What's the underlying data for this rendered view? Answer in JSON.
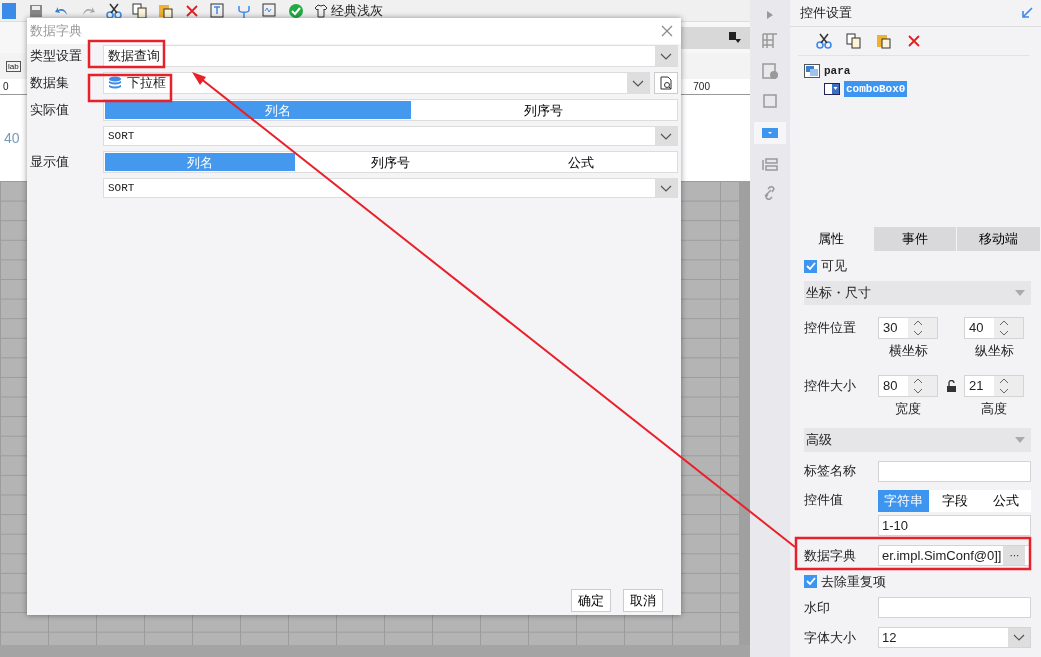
{
  "toolbar": {
    "theme_label": "经典浅灰"
  },
  "ruler": {
    "labels": [
      "0",
      "700"
    ]
  },
  "widget_icon_label": "lab",
  "canvas_hint": "40",
  "dialog": {
    "title": "数据字典",
    "type_label": "类型设置",
    "type_value": "数据查询",
    "dataset_label": "数据集",
    "dataset_value": "下拉框",
    "actual_label": "实际值",
    "actual_tabs": [
      {
        "label": "列名",
        "selected": true
      },
      {
        "label": "列序号",
        "selected": false
      }
    ],
    "actual_value": "SORT",
    "display_label": "显示值",
    "display_tabs": [
      {
        "label": "列名",
        "selected": true
      },
      {
        "label": "列序号",
        "selected": false
      },
      {
        "label": "公式",
        "selected": false
      }
    ],
    "display_value": "SORT",
    "buttons": [
      "确定",
      "取消"
    ]
  },
  "panel": {
    "title": "控件设置",
    "tree": [
      {
        "label": "para",
        "selected": false,
        "children": [
          {
            "label": "comboBox0",
            "selected": true
          }
        ]
      }
    ],
    "tabs": [
      {
        "label": "属性",
        "selected": true
      },
      {
        "label": "事件",
        "selected": false
      },
      {
        "label": "移动端",
        "selected": false
      }
    ],
    "properties": [
      {
        "kind": "checkbox",
        "label": "可见",
        "checked": true
      },
      {
        "kind": "section",
        "label": "坐标・尺寸"
      },
      {
        "kind": "spinners",
        "label": "控件位置",
        "fields": [
          {
            "value": "30",
            "caption": "横坐标"
          },
          {
            "value": "40",
            "caption": "纵坐标"
          }
        ]
      },
      {
        "kind": "spinners",
        "label": "控件大小",
        "lock": true,
        "fields": [
          {
            "value": "80",
            "caption": "宽度"
          },
          {
            "value": "21",
            "caption": "高度"
          }
        ]
      },
      {
        "kind": "section",
        "label": "高级"
      },
      {
        "kind": "text",
        "label": "标签名称"
      },
      {
        "kind": "segmented",
        "label": "控件值",
        "options": [
          {
            "label": "字符串",
            "selected": true
          },
          {
            "label": "字段",
            "selected": false
          },
          {
            "label": "公式",
            "selected": false
          }
        ],
        "value": "1-10"
      },
      {
        "kind": "dict",
        "label": "数据字典",
        "value": "er.impl.SimConf@0]]",
        "button": "···"
      },
      {
        "kind": "checkbox",
        "label": "去除重复项",
        "checked": true
      },
      {
        "kind": "text",
        "label": "水印"
      },
      {
        "kind": "select",
        "label": "字体大小",
        "value": "12"
      }
    ]
  }
}
